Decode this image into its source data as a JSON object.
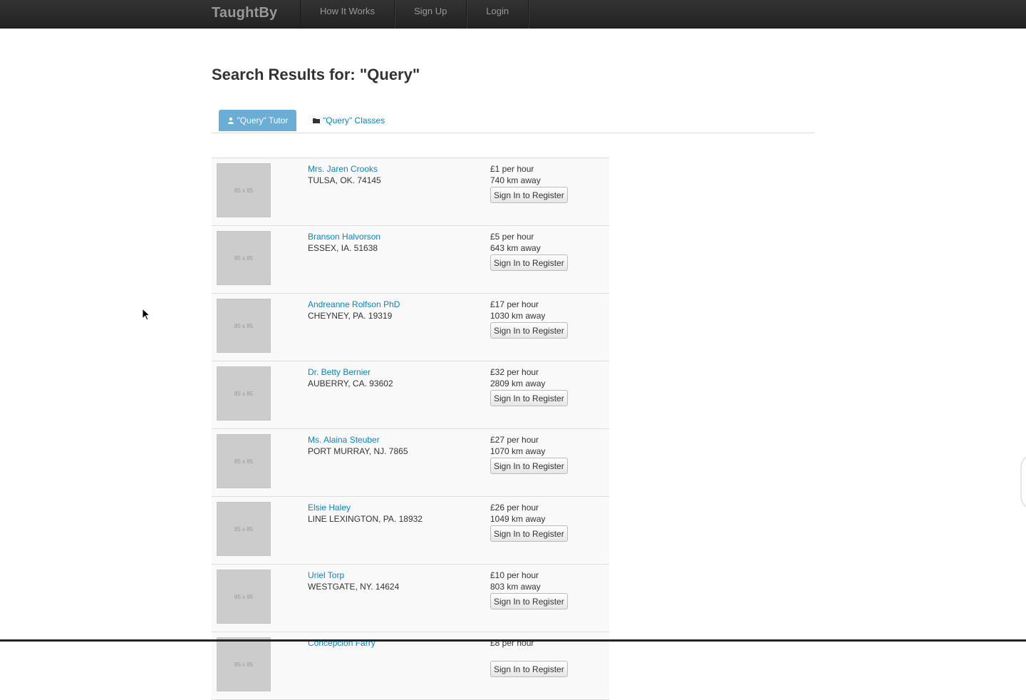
{
  "navbar": {
    "brand": "TaughtBy",
    "links": [
      "How It Works",
      "Sign Up",
      "Login"
    ]
  },
  "page_title": "Search Results for: \"Query\"",
  "tabs": [
    {
      "label": "\"Query\" Tutor",
      "icon": "user-icon",
      "active": true
    },
    {
      "label": "\"Query\" Classes",
      "icon": "folder-icon",
      "active": false
    }
  ],
  "thumbnail_placeholder": "85 x 85",
  "button_label": "Sign In to Register",
  "results": [
    {
      "name": "Mrs. Jaren Crooks",
      "location": "TULSA, OK. 74145",
      "price": "£1 per hour",
      "distance": "740 km away"
    },
    {
      "name": "Branson Halvorson",
      "location": "ESSEX, IA. 51638",
      "price": "£5 per hour",
      "distance": "643 km away"
    },
    {
      "name": "Andreanne Rolfson PhD",
      "location": "CHEYNEY, PA. 19319",
      "price": "£17 per hour",
      "distance": "1030 km away"
    },
    {
      "name": "Dr. Betty Bernier",
      "location": "AUBERRY, CA. 93602",
      "price": "£32 per hour",
      "distance": "2809 km away"
    },
    {
      "name": "Ms. Alaina Steuber",
      "location": "PORT MURRAY, NJ. 7865",
      "price": "£27 per hour",
      "distance": "1070 km away"
    },
    {
      "name": "Elsie Haley",
      "location": "LINE LEXINGTON, PA. 18932",
      "price": "£26 per hour",
      "distance": "1049 km away"
    },
    {
      "name": "Uriel Torp",
      "location": "WESTGATE, NY. 14624",
      "price": "£10 per hour",
      "distance": "803 km away"
    },
    {
      "name": "Concepcion Farry",
      "location": "",
      "price": "£8 per hour",
      "distance": ""
    }
  ]
}
